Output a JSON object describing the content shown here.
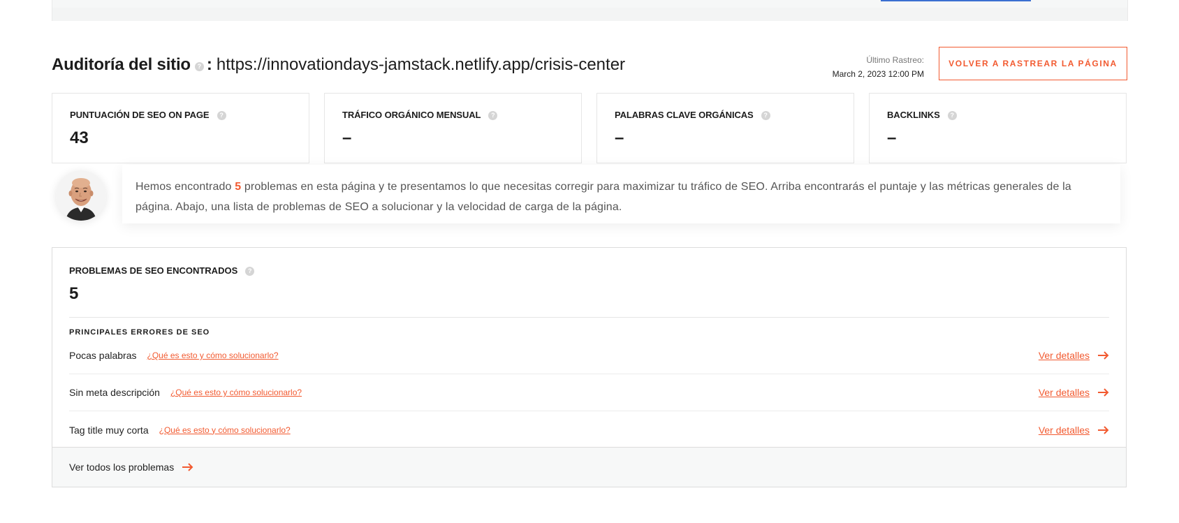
{
  "header": {
    "title": "Auditoría del sitio",
    "separator": ":",
    "url": "https://innovationdays-jamstack.netlify.app/crisis-center",
    "last_crawl_label": "Último Rastreo:",
    "last_crawl_date": "March 2, 2023 12:00 PM",
    "recrawl_button": "VOLVER A RASTREAR LA PÁGINA"
  },
  "metrics": [
    {
      "label": "PUNTUACIÓN DE SEO ON PAGE",
      "value": "43"
    },
    {
      "label": "TRÁFICO ORGÁNICO MENSUAL",
      "value": "–"
    },
    {
      "label": "PALABRAS CLAVE ORGÁNICAS",
      "value": "–"
    },
    {
      "label": "BACKLINKS",
      "value": "–"
    }
  ],
  "message": {
    "before": "Hemos encontrado ",
    "count": "5",
    "after": " problemas en esta página y te presentamos lo que necesitas corregir para maximizar tu tráfico de SEO. Arriba encontrarás el puntaje y las métricas generales de la página. Abajo, una lista de problemas de SEO a solucionar y la velocidad de carga de la página."
  },
  "issues": {
    "label": "PROBLEMAS DE SEO ENCONTRADOS",
    "value": "5",
    "section_title": "PRINCIPALES ERRORES DE SEO",
    "rows": [
      {
        "name": "Pocas palabras",
        "help_link": "¿Qué es esto y cómo solucionarlo?",
        "details": "Ver detalles"
      },
      {
        "name": "Sin meta descripción",
        "help_link": "¿Qué es esto y cómo solucionarlo?",
        "details": "Ver detalles"
      },
      {
        "name": "Tag title muy corta",
        "help_link": "¿Qué es esto y cómo solucionarlo?",
        "details": "Ver detalles"
      }
    ],
    "see_all": "Ver todos los problemas"
  },
  "icons": {
    "help": "question-circle-icon",
    "arrow": "arrow-right-icon"
  },
  "colors": {
    "accent": "#f25a30",
    "help_icon": "#d5d5d5",
    "top_bar_link": "#3b6fd1"
  }
}
